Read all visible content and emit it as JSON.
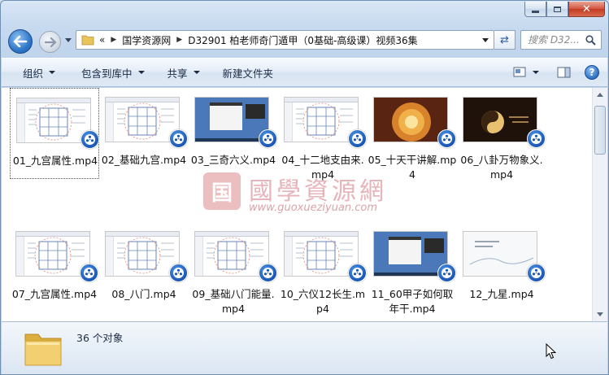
{
  "window": {
    "colors": {
      "accent": "#1a56b5",
      "close": "#c33a22"
    }
  },
  "address": {
    "overflow": "«",
    "crumbs": [
      "国学资源网",
      "D32901  柏老师奇门遁甲（0基础-高级课）视频36集"
    ]
  },
  "search": {
    "placeholder": "搜索 D32..."
  },
  "toolbar": {
    "organize": "组织",
    "include_library": "包含到库中",
    "share": "共享",
    "new_folder": "新建文件夹"
  },
  "files": [
    {
      "name": "01_九宫属性.mp4",
      "thumb": "doc"
    },
    {
      "name": "02_基础九宫.mp4",
      "thumb": "doc"
    },
    {
      "name": "03_三奇六义.mp4",
      "thumb": "desk"
    },
    {
      "name": "04_十二地支由来.mp4",
      "thumb": "doc"
    },
    {
      "name": "05_十天干讲解.mp4",
      "thumb": "dark"
    },
    {
      "name": "06_八卦万物象义.mp4",
      "thumb": "dark2"
    },
    {
      "name": "07_九宫属性.mp4",
      "thumb": "doc"
    },
    {
      "name": "08_八门.mp4",
      "thumb": "doc"
    },
    {
      "name": "09_基础八门能量.mp4",
      "thumb": "doc"
    },
    {
      "name": "10_六仪12长生.mp4",
      "thumb": "doc"
    },
    {
      "name": "11_60甲子如何取年干.mp4",
      "thumb": "desk"
    },
    {
      "name": "12_九星.mp4",
      "thumb": "slide"
    }
  ],
  "details": {
    "count": "36 个对象"
  },
  "watermark": {
    "seal": "国",
    "title": "國學資源網",
    "url": "www.guoxueziyuan.com"
  }
}
